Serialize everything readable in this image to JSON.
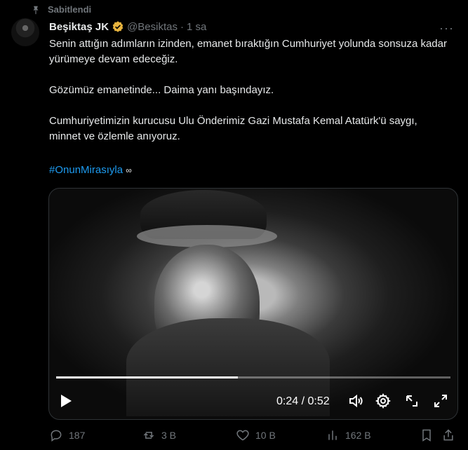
{
  "pinned": {
    "label": "Sabitlendi",
    "icon": "pin-icon"
  },
  "author": {
    "name": "Beşiktaş JK",
    "verified": true,
    "handle": "@Besiktas",
    "dot": "·",
    "time": "1 sa"
  },
  "more": {
    "label": "···"
  },
  "tweet": {
    "text": "Senin attığın adımların izinden, emanet bıraktığın Cumhuriyet yolunda sonsuza kadar yürümeye devam edeceğiz.\n\nGözümüz emanetinde... Daima yanı başındayız.\n\nCumhuriyetimizin kurucusu Ulu Önderimiz Gazi Mustafa Kemal Atatürk'ü saygı, minnet ve özlemle anıyoruz.",
    "hashtag": "#OnunMirasıyla",
    "hashtag_suffix": "∞"
  },
  "video": {
    "time": "0:24 / 0:52",
    "progress": 0.46,
    "icons": [
      "play-icon",
      "volume-icon",
      "settings-icon",
      "pip-icon",
      "fullscreen-icon"
    ]
  },
  "actions": {
    "replies": "187",
    "retweets": "3 B",
    "likes": "10 B",
    "views": "162 B"
  },
  "colors": {
    "background": "#000000",
    "text": "#e7e9ea",
    "muted": "#71767b",
    "link": "#1d9bf0",
    "verified": "#e8b43e"
  }
}
